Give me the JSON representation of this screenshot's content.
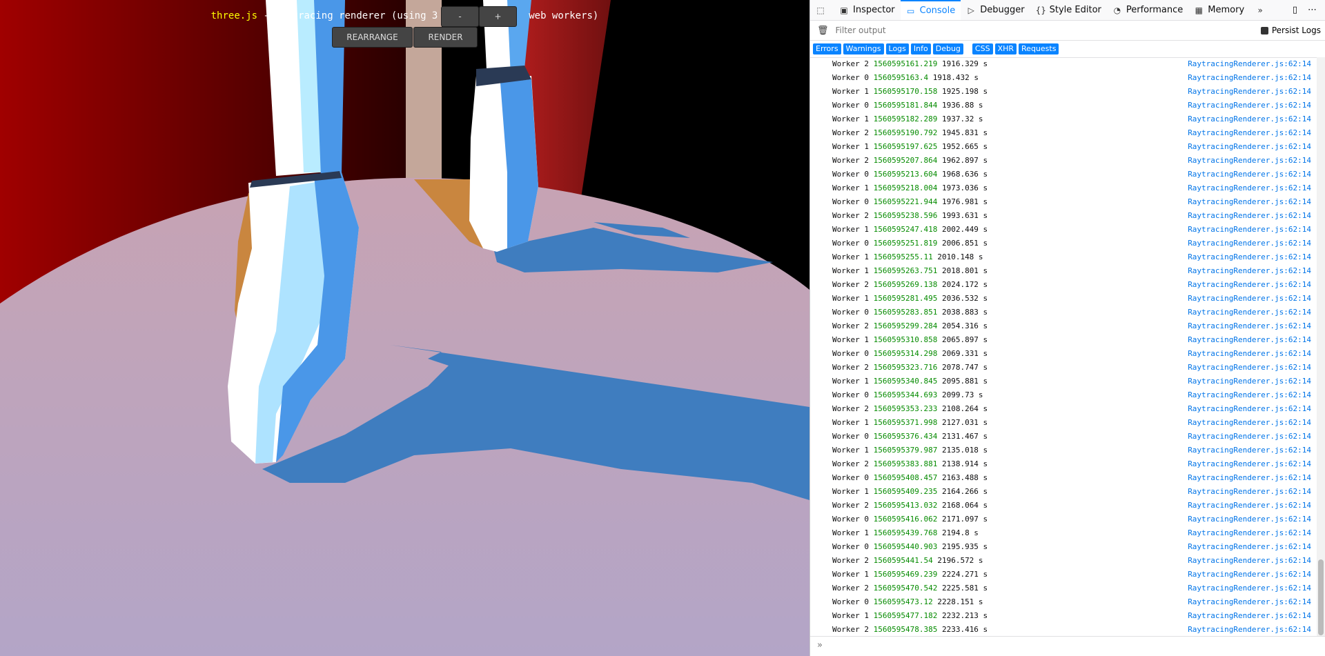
{
  "scene": {
    "info_link": "three.js",
    "info_text": " - raytracing renderer (using 3 ",
    "info_suffix": " web workers)",
    "minus_label": "-",
    "plus_label": "+",
    "rearrange_label": "REARRANGE",
    "render_label": "RENDER"
  },
  "devtools": {
    "tabs": [
      {
        "label": "Inspector",
        "icon": "inspector-icon",
        "glyph": "▣"
      },
      {
        "label": "Console",
        "icon": "console-icon",
        "glyph": "▭"
      },
      {
        "label": "Debugger",
        "icon": "debugger-icon",
        "glyph": "▷"
      },
      {
        "label": "Style Editor",
        "icon": "style-editor-icon",
        "glyph": "{}"
      },
      {
        "label": "Performance",
        "icon": "performance-icon",
        "glyph": "◔"
      },
      {
        "label": "Memory",
        "icon": "memory-icon",
        "glyph": "▦"
      }
    ],
    "selected_tab": "Console",
    "filter_placeholder": "Filter output",
    "persist_logs": "Persist Logs",
    "categories": [
      "Errors",
      "Warnings",
      "Logs",
      "Info",
      "Debug"
    ],
    "net_categories": [
      "CSS",
      "XHR",
      "Requests"
    ],
    "accent": "#0a84ff",
    "timestamp_color": "#058b00",
    "source_color": "#0074e8",
    "source": "RaytracingRenderer.js:62:14",
    "logs": [
      {
        "worker": "Worker 2",
        "ts": "1560595161.219",
        "elapsed": "1916.329 s"
      },
      {
        "worker": "Worker 0",
        "ts": "1560595163.4",
        "elapsed": "1918.432 s"
      },
      {
        "worker": "Worker 1",
        "ts": "1560595170.158",
        "elapsed": "1925.198 s"
      },
      {
        "worker": "Worker 0",
        "ts": "1560595181.844",
        "elapsed": "1936.88 s"
      },
      {
        "worker": "Worker 1",
        "ts": "1560595182.289",
        "elapsed": "1937.32 s"
      },
      {
        "worker": "Worker 2",
        "ts": "1560595190.792",
        "elapsed": "1945.831 s"
      },
      {
        "worker": "Worker 1",
        "ts": "1560595197.625",
        "elapsed": "1952.665 s"
      },
      {
        "worker": "Worker 2",
        "ts": "1560595207.864",
        "elapsed": "1962.897 s"
      },
      {
        "worker": "Worker 0",
        "ts": "1560595213.604",
        "elapsed": "1968.636 s"
      },
      {
        "worker": "Worker 1",
        "ts": "1560595218.004",
        "elapsed": "1973.036 s"
      },
      {
        "worker": "Worker 0",
        "ts": "1560595221.944",
        "elapsed": "1976.981 s"
      },
      {
        "worker": "Worker 2",
        "ts": "1560595238.596",
        "elapsed": "1993.631 s"
      },
      {
        "worker": "Worker 1",
        "ts": "1560595247.418",
        "elapsed": "2002.449 s"
      },
      {
        "worker": "Worker 0",
        "ts": "1560595251.819",
        "elapsed": "2006.851 s"
      },
      {
        "worker": "Worker 1",
        "ts": "1560595255.11",
        "elapsed": "2010.148 s"
      },
      {
        "worker": "Worker 1",
        "ts": "1560595263.751",
        "elapsed": "2018.801 s"
      },
      {
        "worker": "Worker 2",
        "ts": "1560595269.138",
        "elapsed": "2024.172 s"
      },
      {
        "worker": "Worker 1",
        "ts": "1560595281.495",
        "elapsed": "2036.532 s"
      },
      {
        "worker": "Worker 0",
        "ts": "1560595283.851",
        "elapsed": "2038.883 s"
      },
      {
        "worker": "Worker 2",
        "ts": "1560595299.284",
        "elapsed": "2054.316 s"
      },
      {
        "worker": "Worker 1",
        "ts": "1560595310.858",
        "elapsed": "2065.897 s"
      },
      {
        "worker": "Worker 0",
        "ts": "1560595314.298",
        "elapsed": "2069.331 s"
      },
      {
        "worker": "Worker 2",
        "ts": "1560595323.716",
        "elapsed": "2078.747 s"
      },
      {
        "worker": "Worker 1",
        "ts": "1560595340.845",
        "elapsed": "2095.881 s"
      },
      {
        "worker": "Worker 0",
        "ts": "1560595344.693",
        "elapsed": "2099.73 s"
      },
      {
        "worker": "Worker 2",
        "ts": "1560595353.233",
        "elapsed": "2108.264 s"
      },
      {
        "worker": "Worker 1",
        "ts": "1560595371.998",
        "elapsed": "2127.031 s"
      },
      {
        "worker": "Worker 0",
        "ts": "1560595376.434",
        "elapsed": "2131.467 s"
      },
      {
        "worker": "Worker 1",
        "ts": "1560595379.987",
        "elapsed": "2135.018 s"
      },
      {
        "worker": "Worker 2",
        "ts": "1560595383.881",
        "elapsed": "2138.914 s"
      },
      {
        "worker": "Worker 0",
        "ts": "1560595408.457",
        "elapsed": "2163.488 s"
      },
      {
        "worker": "Worker 1",
        "ts": "1560595409.235",
        "elapsed": "2164.266 s"
      },
      {
        "worker": "Worker 2",
        "ts": "1560595413.032",
        "elapsed": "2168.064 s"
      },
      {
        "worker": "Worker 0",
        "ts": "1560595416.062",
        "elapsed": "2171.097 s"
      },
      {
        "worker": "Worker 1",
        "ts": "1560595439.768",
        "elapsed": "2194.8 s"
      },
      {
        "worker": "Worker 0",
        "ts": "1560595440.903",
        "elapsed": "2195.935 s"
      },
      {
        "worker": "Worker 2",
        "ts": "1560595441.54",
        "elapsed": "2196.572 s"
      },
      {
        "worker": "Worker 1",
        "ts": "1560595469.239",
        "elapsed": "2224.271 s"
      },
      {
        "worker": "Worker 2",
        "ts": "1560595470.542",
        "elapsed": "2225.581 s"
      },
      {
        "worker": "Worker 0",
        "ts": "1560595473.12",
        "elapsed": "2228.151 s"
      },
      {
        "worker": "Worker 1",
        "ts": "1560595477.182",
        "elapsed": "2232.213 s"
      },
      {
        "worker": "Worker 2",
        "ts": "1560595478.385",
        "elapsed": "2233.416 s"
      }
    ]
  }
}
